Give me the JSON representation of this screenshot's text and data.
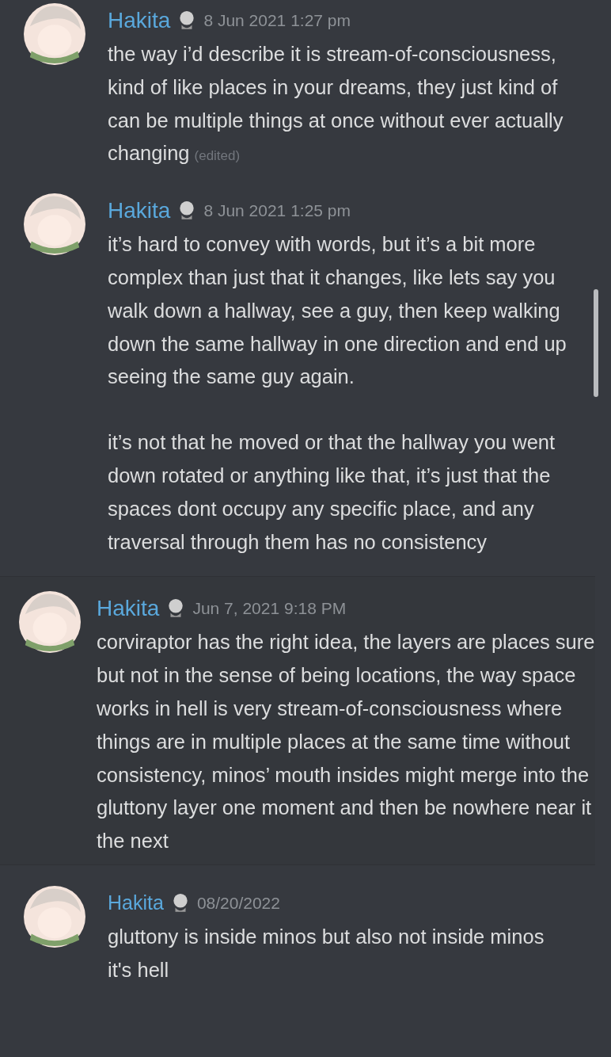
{
  "messages": [
    {
      "kind": "plain",
      "author": "Hakita",
      "timestamp": "8 Jun 2021 1:27 pm",
      "edited_label": "(edited)",
      "paragraphs": [
        "the way i’d describe it is stream-of-consciousness, kind of like places in your dreams, they just kind of can be multiple things at once without ever actually changing"
      ]
    },
    {
      "kind": "plain",
      "author": "Hakita",
      "timestamp": "8 Jun 2021 1:25 pm",
      "paragraphs": [
        "it’s hard to convey with words, but it’s a bit more complex than just that it changes, like lets say you walk down a hallway, see a guy, then keep walking down the same hallway in one direction and end up seeing the same guy again.",
        "it’s not that he moved or that the hallway you went down rotated or anything like that, it’s just that the spaces dont occupy any specific place, and any traversal through them has no consistency"
      ]
    },
    {
      "kind": "bordered",
      "author": "Hakita",
      "timestamp": "Jun 7, 2021 9:18 PM",
      "paragraphs": [
        "corviraptor has the right idea, the layers are places sure but not in the sense of being locations, the way space works in hell is very stream-of-consciousness where things are in multiple places at the same time without consistency, minos’ mouth insides might merge into the gluttony layer one moment and then be nowhere near it the next"
      ]
    },
    {
      "kind": "compact",
      "author": "Hakita",
      "timestamp": "08/20/2022",
      "paragraphs": [
        "gluttony is inside minos but also not inside minos",
        "it's hell"
      ]
    }
  ]
}
